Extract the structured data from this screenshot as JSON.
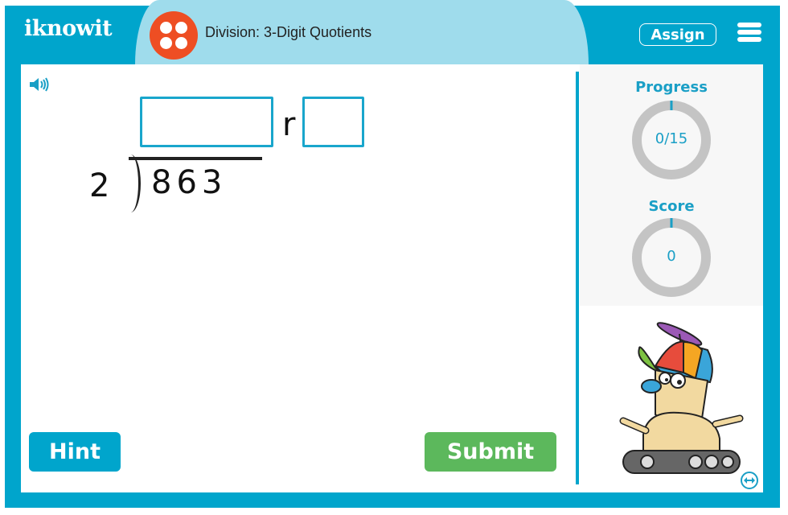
{
  "header": {
    "logo": "iknowit",
    "topic_title": "Division: 3-Digit Quotients",
    "assign_label": "Assign",
    "menu_icon": "hamburger-menu-icon",
    "topic_icon": "four-dots-icon"
  },
  "problem": {
    "speaker_icon": "speaker-icon",
    "divisor": "2",
    "dividend": "863",
    "remainder_label": "r",
    "quotient_value": "",
    "remainder_value": ""
  },
  "buttons": {
    "hint_label": "Hint",
    "submit_label": "Submit"
  },
  "sidebar": {
    "progress_label": "Progress",
    "progress_value": "0/15",
    "progress_fraction": 0,
    "score_label": "Score",
    "score_value": "0",
    "mascot": "robot-mascot-with-propeller-cap",
    "swap_icon": "swap-layout-icon"
  },
  "colors": {
    "brand_blue": "#00a5cc",
    "header_light_blue": "#9fdcec",
    "topic_icon_orange": "#ee4e23",
    "submit_green": "#5cb85c",
    "ring_gray": "#c4c4c4"
  }
}
